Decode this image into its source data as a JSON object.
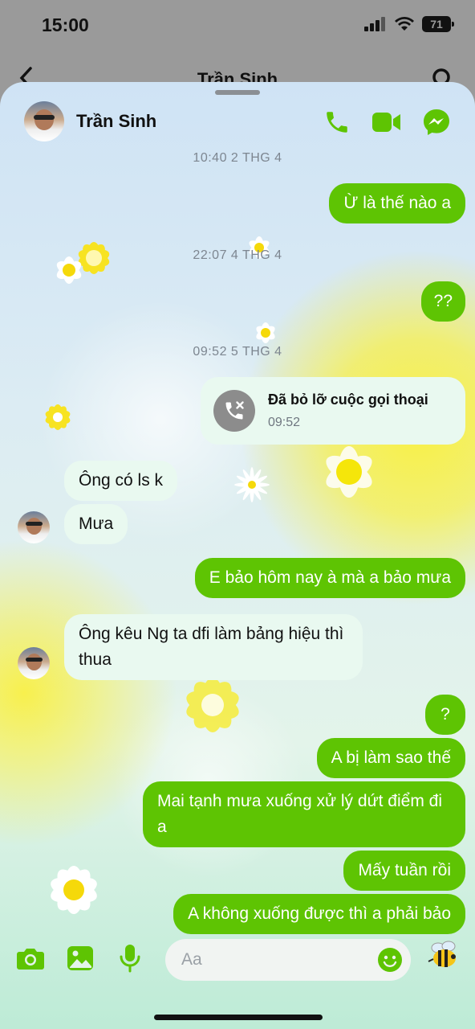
{
  "status_bar": {
    "time": "15:00",
    "battery": "71",
    "icons": [
      "signal-icon",
      "wifi-icon",
      "battery-icon"
    ]
  },
  "background_header": {
    "title": "Trần Sinh",
    "icons": [
      "back-icon",
      "search-icon"
    ]
  },
  "chat_header": {
    "contact_name": "Trần Sinh",
    "icons": [
      "phone-icon",
      "video-call-icon",
      "messenger-icon"
    ],
    "accent_color": "#5ec403"
  },
  "timestamps": [
    "10:40 2 THG 4",
    "22:07 4 THG 4",
    "09:52 5 THG 4"
  ],
  "missed_call": {
    "title": "Đã bỏ lỡ cuộc gọi thoại",
    "time": "09:52",
    "icon": "missed-call-icon"
  },
  "messages": [
    {
      "side": "out",
      "text": "Ừ là thế nào a"
    },
    {
      "side": "out",
      "text": "??"
    },
    {
      "side": "in",
      "text": "Ông có ls k"
    },
    {
      "side": "in",
      "text": "Mưa"
    },
    {
      "side": "out",
      "text": "E bảo hôm nay à mà a bảo mưa"
    },
    {
      "side": "in",
      "text": "Ông kêu Ng ta dfi làm bảng hiệu thì thua"
    },
    {
      "side": "out",
      "text": "?"
    },
    {
      "side": "out",
      "text": "A bị làm sao thế"
    },
    {
      "side": "out",
      "text": "Mai tạnh mưa xuống xử lý dứt điểm đi a"
    },
    {
      "side": "out",
      "text": "Mấy tuần rồi"
    },
    {
      "side": "out",
      "text": "A không xuống được thì a phải bảo"
    }
  ],
  "composer": {
    "placeholder": "Aa",
    "icons": [
      "camera-icon",
      "gallery-icon",
      "microphone-icon",
      "emoji-icon",
      "bee-sticker-icon"
    ]
  },
  "colors": {
    "outgoing_bubble": "#5ec403",
    "incoming_bubble": "#e9f9f0"
  }
}
